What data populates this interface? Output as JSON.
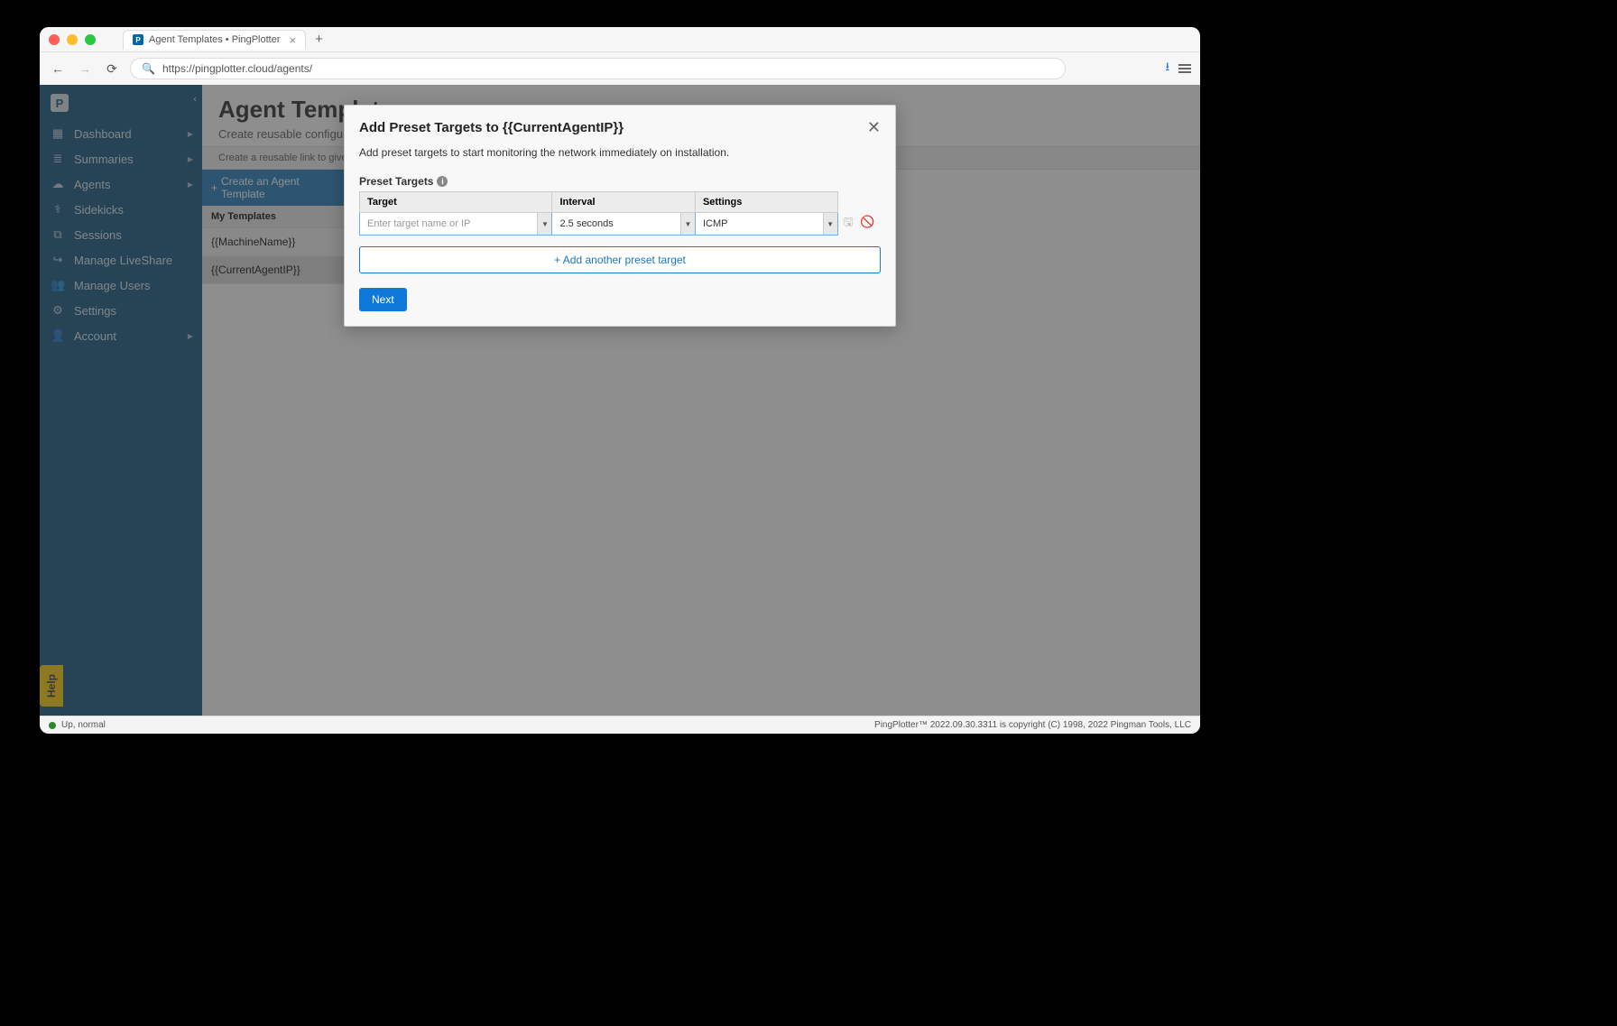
{
  "browser": {
    "tab_title": "Agent Templates • PingPlotter",
    "url": "https://pingplotter.cloud/agents/"
  },
  "sidebar": {
    "items": [
      {
        "icon": "▦",
        "label": "Dashboard",
        "caret": true
      },
      {
        "icon": "≣",
        "label": "Summaries",
        "caret": true
      },
      {
        "icon": "☁",
        "label": "Agents",
        "caret": true
      },
      {
        "icon": "⚕",
        "label": "Sidekicks",
        "caret": false
      },
      {
        "icon": "⧉",
        "label": "Sessions",
        "caret": false
      },
      {
        "icon": "↪",
        "label": "Manage LiveShare",
        "caret": false
      },
      {
        "icon": "👥",
        "label": "Manage Users",
        "caret": false
      },
      {
        "icon": "⚙",
        "label": "Settings",
        "caret": false
      },
      {
        "icon": "👤",
        "label": "Account",
        "caret": true
      }
    ],
    "help_label": "Help"
  },
  "page": {
    "title": "Agent Templates",
    "subtitle": "Create reusable configurations",
    "info_text": "Create a reusable link to give to end users to install a pre-configured agent where you can monitor their network.",
    "create_button": "Create an Agent Template",
    "my_templates_header": "My Templates",
    "templates": [
      {
        "name": "{{MachineName}}",
        "selected": false
      },
      {
        "name": "{{CurrentAgentIP}}",
        "selected": true
      }
    ]
  },
  "modal": {
    "title": "Add Preset Targets to {{CurrentAgentIP}}",
    "description": "Add preset targets to start monitoring the network immediately on installation.",
    "preset_label": "Preset Targets",
    "columns": {
      "target": "Target",
      "interval": "Interval",
      "settings": "Settings"
    },
    "row": {
      "target_placeholder": "Enter target name or IP",
      "interval_value": "2.5 seconds",
      "settings_value": "ICMP"
    },
    "add_button": "Add another preset target",
    "next_button": "Next"
  },
  "status": {
    "text": "Up, normal",
    "footer": "PingPlotter™ 2022.09.30.3311 is copyright (C) 1998, 2022 Pingman Tools, LLC"
  }
}
